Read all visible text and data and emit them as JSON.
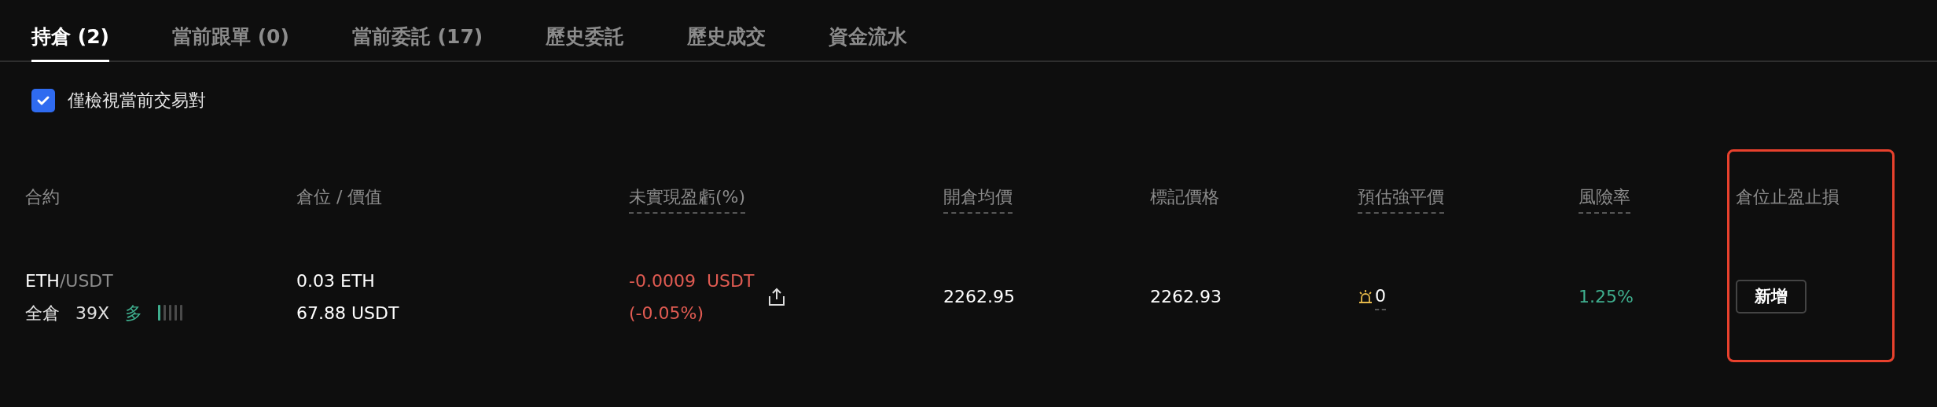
{
  "tabs": [
    {
      "label": "持倉 (2)",
      "selected": true
    },
    {
      "label": "當前跟單 (0)",
      "selected": false
    },
    {
      "label": "當前委託 (17)",
      "selected": false
    },
    {
      "label": "歷史委託",
      "selected": false
    },
    {
      "label": "歷史成交",
      "selected": false
    },
    {
      "label": "資金流水",
      "selected": false
    }
  ],
  "filter": {
    "label": "僅檢視當前交易對",
    "checked": true
  },
  "table": {
    "columns": [
      {
        "label": "合約",
        "underlined": false,
        "highlighted": false
      },
      {
        "label": "倉位 / 價值",
        "underlined": false,
        "highlighted": false
      },
      {
        "label": "未實現盈虧(%)",
        "underlined": true,
        "highlighted": false
      },
      {
        "label": "開倉均價",
        "underlined": true,
        "highlighted": false
      },
      {
        "label": "標記價格",
        "underlined": false,
        "highlighted": false
      },
      {
        "label": "預估強平價",
        "underlined": true,
        "highlighted": false
      },
      {
        "label": "風險率",
        "underlined": true,
        "highlighted": false
      },
      {
        "label": "倉位止盈止損",
        "underlined": false,
        "highlighted": true
      }
    ],
    "rows": [
      {
        "base": "ETH",
        "quote": "/USDT",
        "margin_mode": "全倉",
        "leverage": "39X",
        "side": "多",
        "adl": {
          "level": 0.2
        },
        "size": "0.03 ETH",
        "value": "67.88 USDT",
        "pnl": "-0.0009  USDT",
        "pnl_pct": "(-0.05%)",
        "entry_price": "2262.95",
        "mark_price": "2262.93",
        "liq_price": "0",
        "risk": "1.25%",
        "tpsl_button": "新增"
      }
    ]
  }
}
